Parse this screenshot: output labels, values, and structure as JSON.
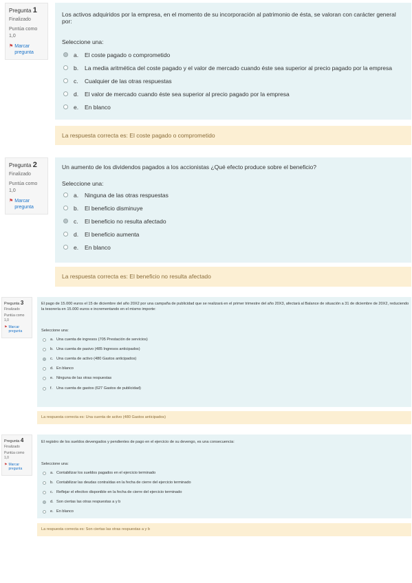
{
  "questions": [
    {
      "number_label": "Pregunta",
      "number": "1",
      "state": "Finalizado",
      "grade": "Puntúa como 1,0",
      "flag": "Marcar pregunta",
      "text": "Los activos adquiridos por la empresa, en el momento de su incorporación al patrimonio de ésta, se valoran con carácter general por:",
      "prompt": "Seleccione una:",
      "answers": [
        {
          "letter": "a.",
          "text": "El coste pagado o comprometido",
          "selected": true
        },
        {
          "letter": "b.",
          "text": "La media aritmética del coste pagado y el valor de mercado cuando éste sea superior al precio pagado por la empresa",
          "selected": false
        },
        {
          "letter": "c.",
          "text": "Cualquier de las otras respuestas",
          "selected": false
        },
        {
          "letter": "d.",
          "text": "El valor de mercado cuando éste sea superior al precio pagado por la empresa",
          "selected": false
        },
        {
          "letter": "e.",
          "text": "En blanco",
          "selected": false
        }
      ],
      "feedback": "La respuesta correcta es: El coste pagado o comprometido"
    },
    {
      "number_label": "Pregunta",
      "number": "2",
      "state": "Finalizado",
      "grade": "Puntúa como 1,0",
      "flag": "Marcar pregunta",
      "text": "Un aumento de los dividendos pagados a los accionistas ¿Qué efecto produce sobre el beneficio?",
      "prompt": "Seleccione una:",
      "answers": [
        {
          "letter": "a.",
          "text": "Ninguna de las otras respuestas",
          "selected": false
        },
        {
          "letter": "b.",
          "text": "El beneficio disminuye",
          "selected": false
        },
        {
          "letter": "c.",
          "text": "El beneficio no resulta afectado",
          "selected": true
        },
        {
          "letter": "d.",
          "text": "El beneficio aumenta",
          "selected": false
        },
        {
          "letter": "e.",
          "text": "En blanco",
          "selected": false
        }
      ],
      "feedback": "La respuesta correcta es: El beneficio no resulta afectado"
    },
    {
      "number_label": "Pregunta",
      "number": "3",
      "state": "Finalizado",
      "grade": "Puntúa como 1,0",
      "flag": "Marcar pregunta",
      "text": "El pago de 15.000 euros el 15 de diciembre del año 20X2 por una campaña de publicidad que se realizará en el primer trimestre del año 20X3, afectará al Balance de situación a 31 de diciembre de 20X2, reduciendo la tesorería en 15.000 euros e incrementando en el mismo importe:",
      "prompt": "Seleccione una:",
      "answers": [
        {
          "letter": "a.",
          "text": "Una cuenta de ingresos (705 Prestación de servicios)",
          "selected": false
        },
        {
          "letter": "b.",
          "text": "Una cuenta de pasivo (485 Ingresos anticipados)",
          "selected": false
        },
        {
          "letter": "c.",
          "text": "Una cuenta de activo (480 Gastos anticipados)",
          "selected": true
        },
        {
          "letter": "d.",
          "text": "En blanco",
          "selected": false
        },
        {
          "letter": "e.",
          "text": "Ninguna de las otras respuestas",
          "selected": false
        },
        {
          "letter": "f.",
          "text": "Una cuenta de gastos (627 Gastos de publicidad)",
          "selected": false
        }
      ],
      "feedback": "La respuesta correcta es: Una cuenta de activo (480 Gastos anticipados)"
    },
    {
      "number_label": "Pregunta",
      "number": "4",
      "state": "Finalizado",
      "grade": "Puntúa como 1,0",
      "flag": "Marcar pregunta",
      "text": "El registro de los sueldos devengados y pendientes de pago en el ejercicio de su devengo, es una consecuencia:",
      "prompt": "Seleccione una:",
      "answers": [
        {
          "letter": "a.",
          "text": "Contabilizar los sueldos pagados en el ejercicio terminado",
          "selected": false
        },
        {
          "letter": "b.",
          "text": "Contabilizar las deudas contraídas en la fecha de cierre del ejercicio terminado",
          "selected": false
        },
        {
          "letter": "c.",
          "text": "Reflejar el efectivo disponible en la fecha de cierre del ejercicio terminado",
          "selected": false
        },
        {
          "letter": "d.",
          "text": "Son ciertas las otras respuestas a y b",
          "selected": true
        },
        {
          "letter": "e.",
          "text": "En blanco",
          "selected": false
        }
      ],
      "feedback": "La respuesta correcta es: Son ciertas las otras respuestas a y b"
    }
  ]
}
